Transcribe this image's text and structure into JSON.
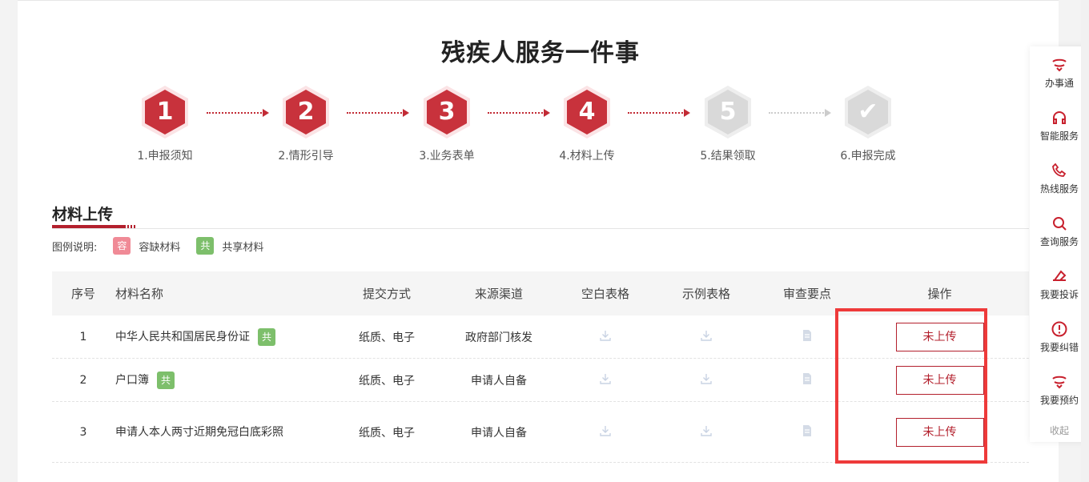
{
  "title": "残疾人服务一件事",
  "colors": {
    "accent": "#b3202d",
    "active_step": "#c8323c",
    "inactive_step": "#d9d9d9",
    "highlight_box": "#ee3a3a"
  },
  "steps": [
    {
      "num": "1",
      "label": "1.申报须知",
      "state": "done"
    },
    {
      "num": "2",
      "label": "2.情形引导",
      "state": "done"
    },
    {
      "num": "3",
      "label": "3.业务表单",
      "state": "done"
    },
    {
      "num": "4",
      "label": "4.材料上传",
      "state": "current"
    },
    {
      "num": "5",
      "label": "5.结果领取",
      "state": "pending"
    },
    {
      "num": "✔",
      "label": "6.申报完成",
      "state": "pending"
    }
  ],
  "section": {
    "title": "材料上传"
  },
  "legend": {
    "label": "图例说明:",
    "items": [
      {
        "badge": "容",
        "text": "容缺材料",
        "color": "pink"
      },
      {
        "badge": "共",
        "text": "共享材料",
        "color": "green"
      }
    ]
  },
  "table": {
    "headers": [
      "序号",
      "材料名称",
      "提交方式",
      "来源渠道",
      "空白表格",
      "示例表格",
      "审查要点",
      "操作"
    ],
    "rows": [
      {
        "index": "1",
        "name": "中华人民共和国居民身份证",
        "badge": "共",
        "method": "纸质、电子",
        "source": "政府部门核发",
        "action": "未上传"
      },
      {
        "index": "2",
        "name": "户口簿",
        "badge": "共",
        "method": "纸质、电子",
        "source": "申请人自备",
        "action": "未上传"
      },
      {
        "index": "3",
        "name": "申请人本人两寸近期免冠白底彩照",
        "badge": "",
        "method": "纸质、电子",
        "source": "申请人自备",
        "action": "未上传"
      }
    ]
  },
  "sidebar": {
    "items": [
      {
        "label": "办事通",
        "icon": "banshitong-icon"
      },
      {
        "label": "智能服务",
        "icon": "headset-icon"
      },
      {
        "label": "热线服务",
        "icon": "phone-icon"
      },
      {
        "label": "查询服务",
        "icon": "search-icon"
      },
      {
        "label": "我要投诉",
        "icon": "complaint-icon"
      },
      {
        "label": "我要纠错",
        "icon": "alert-icon"
      },
      {
        "label": "我要预约",
        "icon": "appointment-icon"
      }
    ],
    "collapse": "收起"
  }
}
